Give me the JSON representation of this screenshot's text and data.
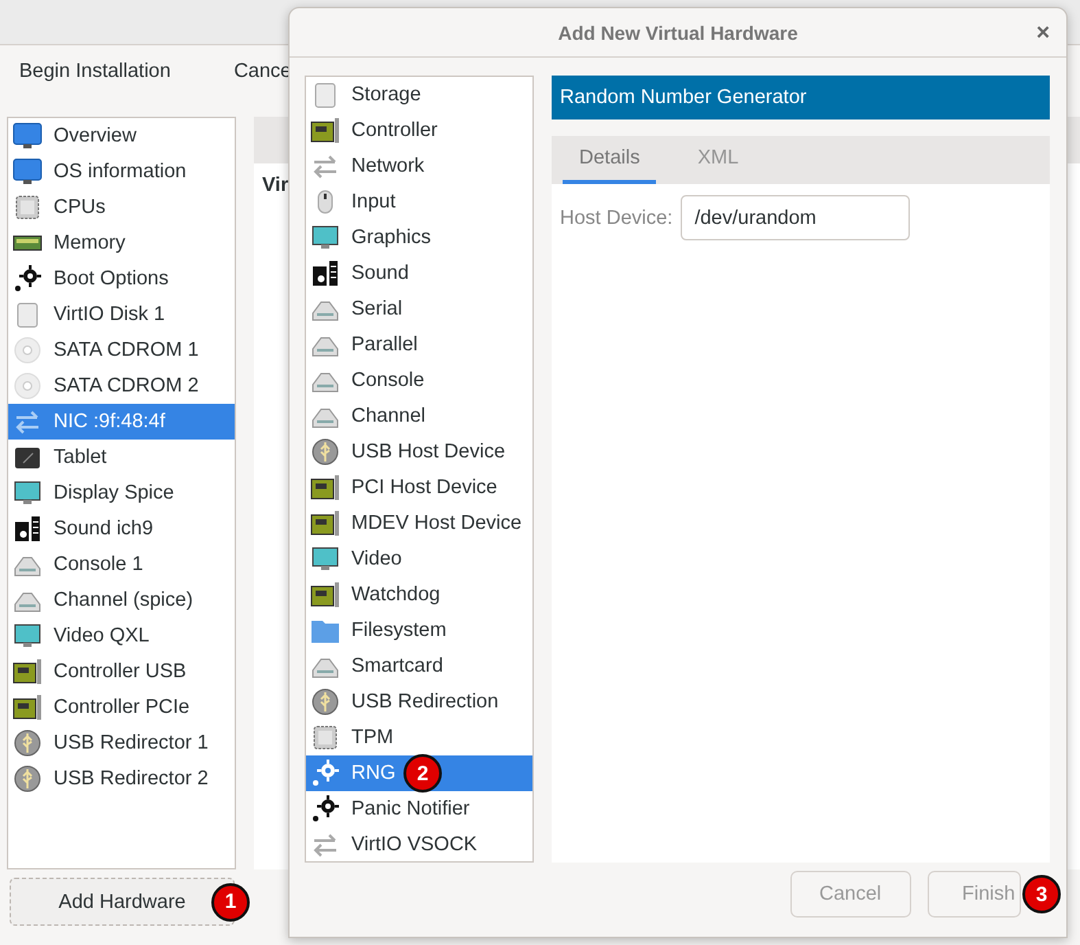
{
  "main_window": {
    "toolbar": [
      {
        "label": "Begin Installation"
      },
      {
        "label": "Cance"
      }
    ],
    "hardware_list": [
      {
        "label": "Overview",
        "kind": "monitor",
        "selected": false
      },
      {
        "label": "OS information",
        "kind": "monitor",
        "selected": false
      },
      {
        "label": "CPUs",
        "kind": "chip",
        "selected": false
      },
      {
        "label": "Memory",
        "kind": "memory",
        "selected": false
      },
      {
        "label": "Boot Options",
        "kind": "gear",
        "selected": false
      },
      {
        "label": "VirtIO Disk 1",
        "kind": "disk",
        "selected": false
      },
      {
        "label": "SATA CDROM 1",
        "kind": "cdrom",
        "selected": false
      },
      {
        "label": "SATA CDROM 2",
        "kind": "cdrom",
        "selected": false
      },
      {
        "label": "NIC :9f:48:4f",
        "kind": "network",
        "selected": true
      },
      {
        "label": "Tablet",
        "kind": "tablet",
        "selected": false
      },
      {
        "label": "Display Spice",
        "kind": "display",
        "selected": false
      },
      {
        "label": "Sound ich9",
        "kind": "sound",
        "selected": false
      },
      {
        "label": "Console 1",
        "kind": "serial",
        "selected": false
      },
      {
        "label": "Channel (spice)",
        "kind": "serial",
        "selected": false
      },
      {
        "label": "Video QXL",
        "kind": "display",
        "selected": false
      },
      {
        "label": "Controller USB",
        "kind": "card",
        "selected": false
      },
      {
        "label": "Controller PCIe",
        "kind": "card",
        "selected": false
      },
      {
        "label": "USB Redirector 1",
        "kind": "usb",
        "selected": false
      },
      {
        "label": "USB Redirector 2",
        "kind": "usb",
        "selected": false
      }
    ],
    "add_button": {
      "label": "Add Hardware",
      "badge": "1"
    },
    "section_title": "Vir"
  },
  "dialog": {
    "title": "Add New Virtual Hardware",
    "close": "×",
    "device_types": [
      {
        "label": "Storage",
        "kind": "disk",
        "selected": false
      },
      {
        "label": "Controller",
        "kind": "card",
        "selected": false
      },
      {
        "label": "Network",
        "kind": "network",
        "selected": false
      },
      {
        "label": "Input",
        "kind": "mouse",
        "selected": false
      },
      {
        "label": "Graphics",
        "kind": "display",
        "selected": false
      },
      {
        "label": "Sound",
        "kind": "sound",
        "selected": false
      },
      {
        "label": "Serial",
        "kind": "serial",
        "selected": false
      },
      {
        "label": "Parallel",
        "kind": "serial",
        "selected": false
      },
      {
        "label": "Console",
        "kind": "serial",
        "selected": false
      },
      {
        "label": "Channel",
        "kind": "serial",
        "selected": false
      },
      {
        "label": "USB Host Device",
        "kind": "usb",
        "selected": false
      },
      {
        "label": "PCI Host Device",
        "kind": "card",
        "selected": false
      },
      {
        "label": "MDEV Host Device",
        "kind": "card",
        "selected": false
      },
      {
        "label": "Video",
        "kind": "display",
        "selected": false
      },
      {
        "label": "Watchdog",
        "kind": "card",
        "selected": false
      },
      {
        "label": "Filesystem",
        "kind": "folder",
        "selected": false
      },
      {
        "label": "Smartcard",
        "kind": "serial",
        "selected": false
      },
      {
        "label": "USB Redirection",
        "kind": "usb",
        "selected": false
      },
      {
        "label": "TPM",
        "kind": "chip",
        "selected": false
      },
      {
        "label": "RNG",
        "kind": "gear",
        "selected": true,
        "badge": "2"
      },
      {
        "label": "Panic Notifier",
        "kind": "gear",
        "selected": false
      },
      {
        "label": "VirtIO VSOCK",
        "kind": "network",
        "selected": false
      }
    ],
    "header": "Random Number Generator",
    "tabs": [
      {
        "label": "Details",
        "selected": true
      },
      {
        "label": "XML",
        "selected": false
      }
    ],
    "host_device": {
      "label": "Host Device:",
      "value": "/dev/urandom"
    },
    "buttons": [
      {
        "label": "Cancel"
      },
      {
        "label": "Finish",
        "badge": "3"
      }
    ]
  }
}
